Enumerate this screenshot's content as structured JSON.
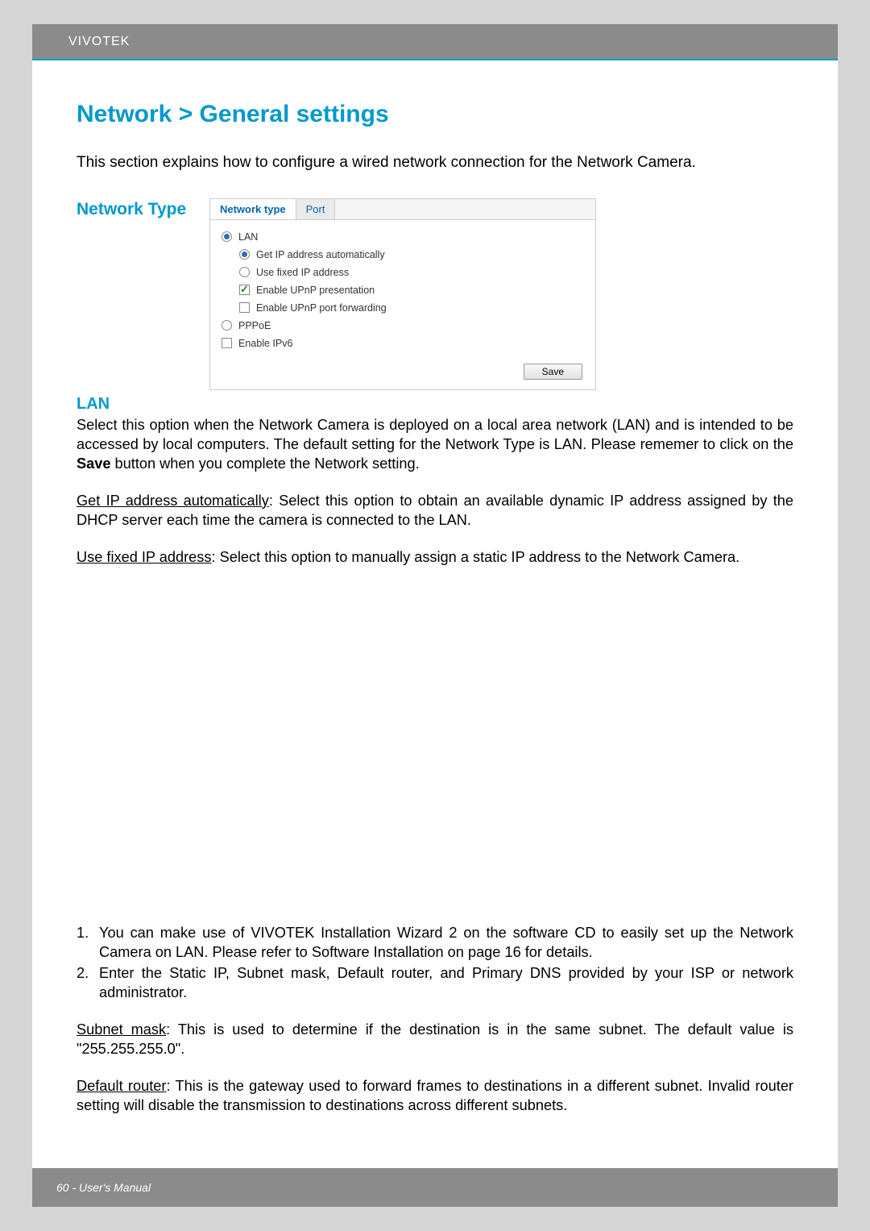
{
  "header": {
    "brand": "VIVOTEK"
  },
  "title": "Network > General settings",
  "intro": "This section explains how to configure a wired network connection for the Network Camera.",
  "network_type": {
    "label": "Network Type",
    "tabs": {
      "active": "Network type",
      "inactive": "Port"
    },
    "options": {
      "lan": "LAN",
      "get_ip": "Get IP address automatically",
      "fixed_ip": "Use fixed IP address",
      "upnp_pres": "Enable UPnP presentation",
      "upnp_port": "Enable UPnP port forwarding",
      "pppoe": "PPPoE",
      "ipv6": "Enable IPv6"
    },
    "save": "Save"
  },
  "lan": {
    "heading": "LAN",
    "para1_a": "Select this option when the Network Camera is deployed on a local area network (LAN) and is intended to be accessed by local computers. The default setting for the Network Type is LAN. Please rememer to click on the ",
    "para1_bold": "Save",
    "para1_b": " button when you complete the Network setting.",
    "getip_u": "Get IP address automatically",
    "getip_t": ": Select this option to obtain an available dynamic IP address assigned by the DHCP server each time the camera is connected to the LAN.",
    "fixed_u": "Use fixed IP address",
    "fixed_t": ": Select this option to manually assign a static IP address to the Network Camera."
  },
  "list": {
    "n1": "1.",
    "t1": "You can make use of VIVOTEK Installation Wizard 2 on the software CD to easily set up the Network Camera on LAN. Please refer to Software Installation on page 16 for details.",
    "n2": "2.",
    "t2": "Enter the Static IP, Subnet mask, Default router, and Primary DNS provided by your ISP or network administrator."
  },
  "subnet": {
    "u": "Subnet mask",
    "t": ": This is used to determine if the destination is in the same subnet. The default value is \"255.255.255.0\"."
  },
  "router": {
    "u": "Default router",
    "t": ": This is the gateway used to forward frames to destinations in a different subnet. Invalid router setting will disable the transmission to destinations across different subnets."
  },
  "footer": "60 - User's Manual"
}
